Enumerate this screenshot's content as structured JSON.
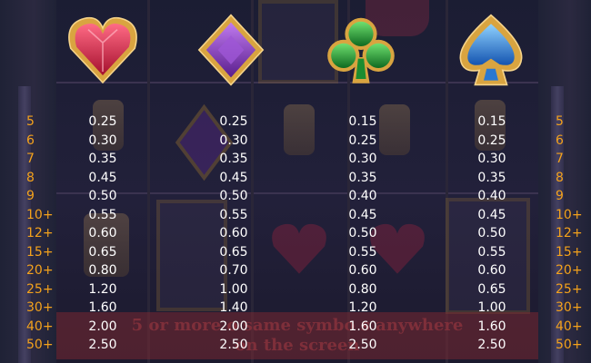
{
  "counts": [
    "5",
    "6",
    "7",
    "8",
    "9",
    "10+",
    "12+",
    "15+",
    "20+",
    "25+",
    "30+",
    "40+",
    "50+"
  ],
  "symbols": [
    {
      "name": "heart",
      "color": "#d4244a",
      "values": [
        "0.25",
        "0.30",
        "0.35",
        "0.45",
        "0.50",
        "0.55",
        "0.60",
        "0.65",
        "0.80",
        "1.20",
        "1.60",
        "2.00",
        "2.50"
      ]
    },
    {
      "name": "diamond",
      "color": "#8e3dc4",
      "values": [
        "0.25",
        "0.30",
        "0.35",
        "0.45",
        "0.50",
        "0.55",
        "0.60",
        "0.65",
        "0.70",
        "1.00",
        "1.40",
        "2.00",
        "2.50"
      ]
    },
    {
      "name": "club",
      "color": "#27a23a",
      "values": [
        "0.15",
        "0.25",
        "0.30",
        "0.35",
        "0.40",
        "0.45",
        "0.50",
        "0.55",
        "0.60",
        "0.80",
        "1.20",
        "1.60",
        "2.50"
      ]
    },
    {
      "name": "spade",
      "color": "#2f8de0",
      "values": [
        "0.15",
        "0.25",
        "0.30",
        "0.35",
        "0.40",
        "0.45",
        "0.50",
        "0.55",
        "0.60",
        "0.65",
        "1.00",
        "1.60",
        "2.50"
      ]
    }
  ],
  "banner": {
    "line1": "5 or more o   same symbo   s anywhere",
    "line2": "on the screen"
  },
  "colors": {
    "count": "#f4a21c",
    "value": "#ffffff",
    "frame_gold": "#d9a440"
  }
}
